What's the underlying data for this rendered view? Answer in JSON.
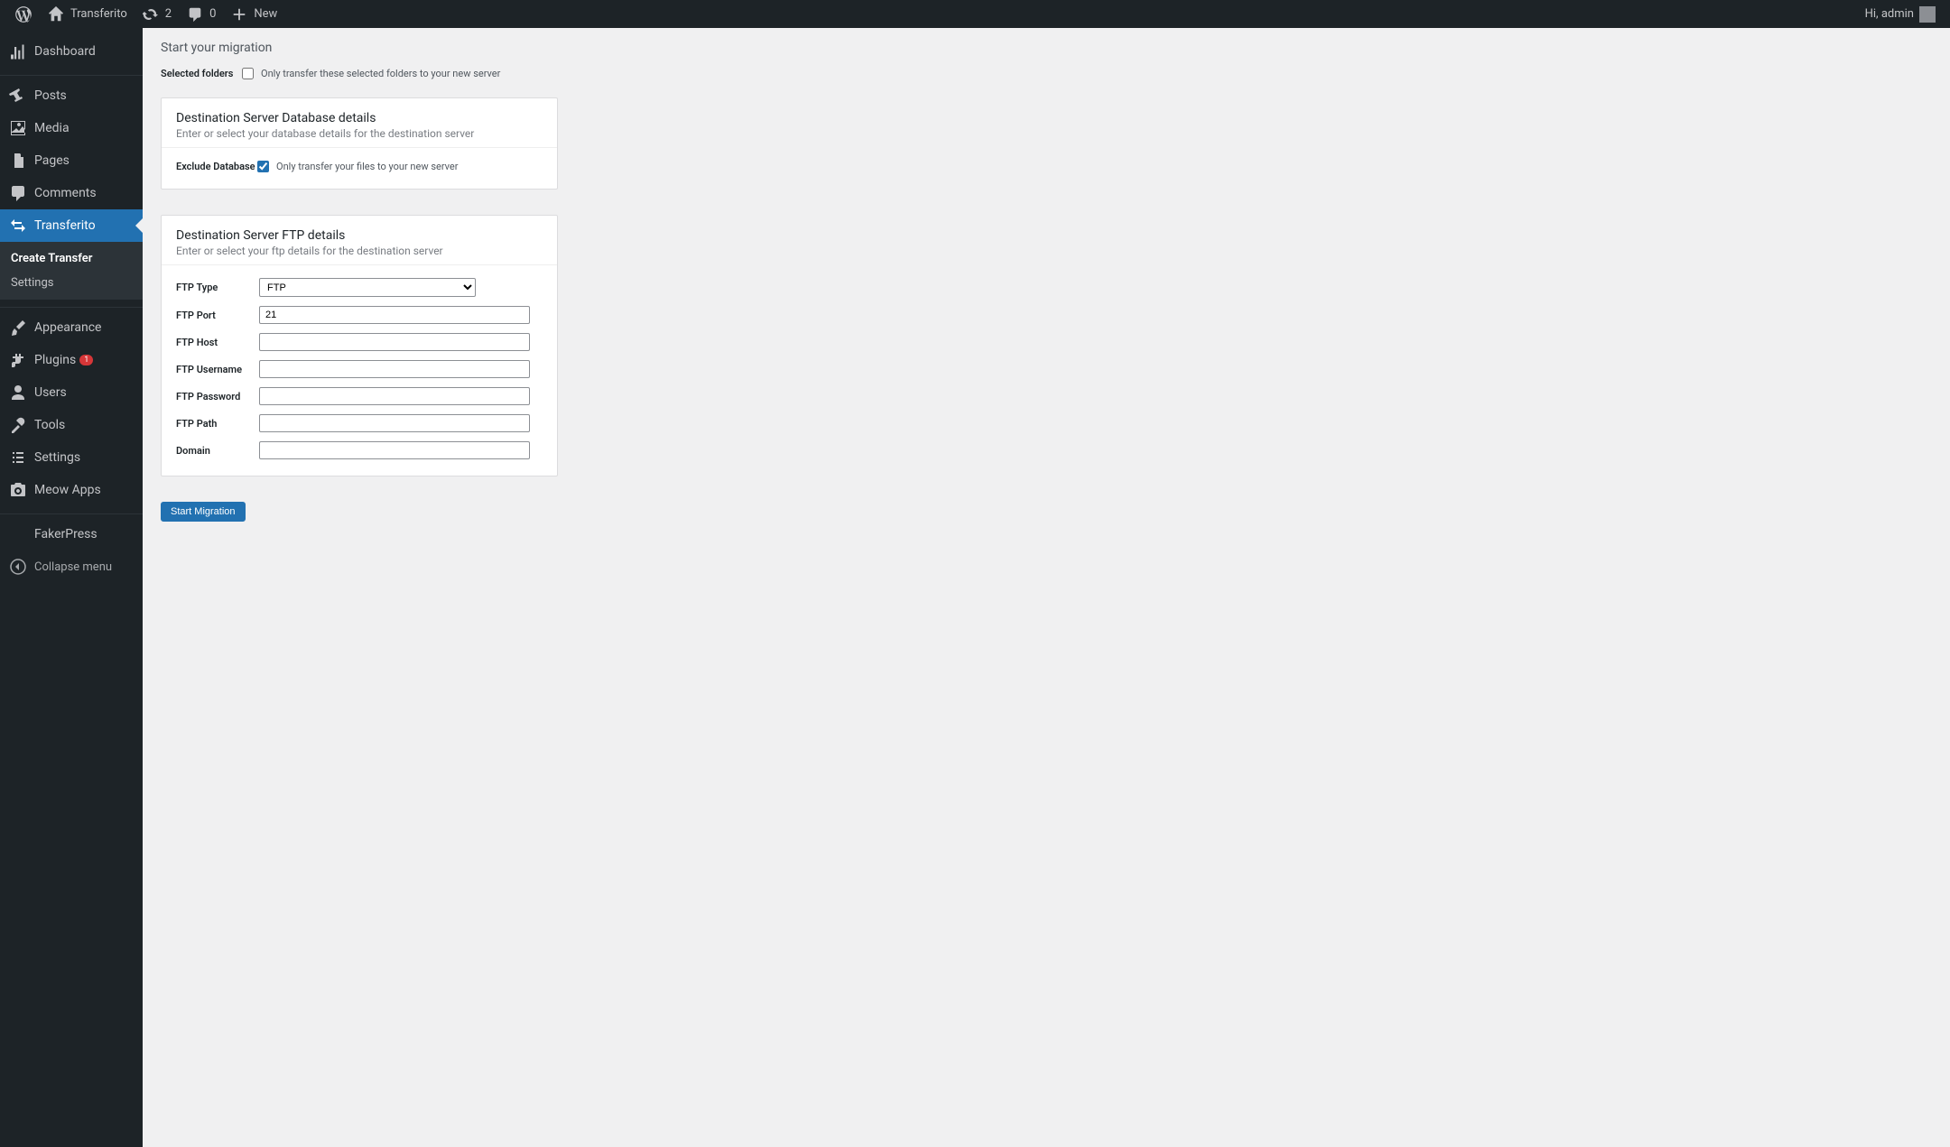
{
  "adminbar": {
    "site_name": "Transferito",
    "updates_count": "2",
    "comments_count": "0",
    "new_label": "New",
    "greeting": "Hi, admin"
  },
  "sidebar": {
    "items": [
      {
        "key": "dashboard",
        "label": "Dashboard"
      },
      {
        "key": "posts",
        "label": "Posts"
      },
      {
        "key": "media",
        "label": "Media"
      },
      {
        "key": "pages",
        "label": "Pages"
      },
      {
        "key": "comments",
        "label": "Comments"
      },
      {
        "key": "transferito",
        "label": "Transferito"
      },
      {
        "key": "appearance",
        "label": "Appearance"
      },
      {
        "key": "plugins",
        "label": "Plugins",
        "badge": "1"
      },
      {
        "key": "users",
        "label": "Users"
      },
      {
        "key": "tools",
        "label": "Tools"
      },
      {
        "key": "settings",
        "label": "Settings"
      },
      {
        "key": "meow",
        "label": "Meow Apps"
      },
      {
        "key": "fakerpress",
        "label": "FakerPress"
      }
    ],
    "submenu": [
      {
        "label": "Create Transfer",
        "current": true
      },
      {
        "label": "Settings",
        "current": false
      }
    ],
    "collapse_label": "Collapse menu"
  },
  "main": {
    "title": "Start your migration",
    "selected_folders": {
      "label": "Selected folders",
      "checkbox_label": "Only transfer these selected folders to your new server",
      "checked": false
    },
    "db_panel": {
      "title": "Destination Server Database details",
      "subtitle": "Enter or select your database details for the destination server",
      "exclude_label": "Exclude Database",
      "exclude_desc": "Only transfer your files to your new server",
      "exclude_checked": true
    },
    "ftp_panel": {
      "title": "Destination Server FTP details",
      "subtitle": "Enter or select your ftp details for the destination server",
      "fields": {
        "type_label": "FTP Type",
        "type_value": "FTP",
        "port_label": "FTP Port",
        "port_value": "21",
        "host_label": "FTP Host",
        "host_value": "",
        "user_label": "FTP Username",
        "user_value": "",
        "pass_label": "FTP Password",
        "pass_value": "",
        "path_label": "FTP Path",
        "path_value": "",
        "domain_label": "Domain",
        "domain_value": ""
      }
    },
    "submit_label": "Start Migration"
  }
}
